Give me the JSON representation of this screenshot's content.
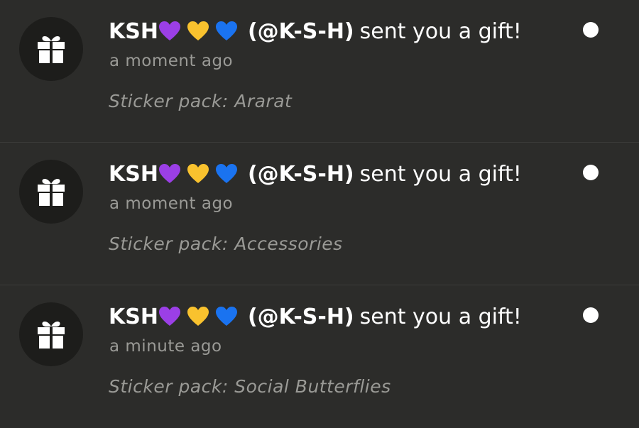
{
  "notifications": [
    {
      "sender_name": "KSH",
      "hearts": [
        "purple-heart",
        "yellow-heart",
        "blue-heart"
      ],
      "handle": "(@K-S-H)",
      "action": "sent you a gift!",
      "time": "a moment ago",
      "detail": "Sticker pack: Ararat",
      "unread": true,
      "icon": "gift-icon"
    },
    {
      "sender_name": "KSH",
      "hearts": [
        "purple-heart",
        "yellow-heart",
        "blue-heart"
      ],
      "handle": "(@K-S-H)",
      "action": "sent you a gift!",
      "time": "a moment ago",
      "detail": "Sticker pack: Accessories",
      "unread": true,
      "icon": "gift-icon"
    },
    {
      "sender_name": "KSH",
      "hearts": [
        "purple-heart",
        "yellow-heart",
        "blue-heart"
      ],
      "handle": "(@K-S-H)",
      "action": "sent you a gift!",
      "time": "a minute ago",
      "detail": "Sticker pack: Social Butterflies",
      "unread": true,
      "icon": "gift-icon"
    }
  ],
  "colors": {
    "background": "#2c2c2a",
    "avatar_bg": "#1d1d1b",
    "text_primary": "#ffffff",
    "text_secondary": "#9a9a96",
    "purple_heart": "#9b3fe6",
    "yellow_heart": "#f9c22e",
    "blue_heart": "#1a73f0"
  }
}
